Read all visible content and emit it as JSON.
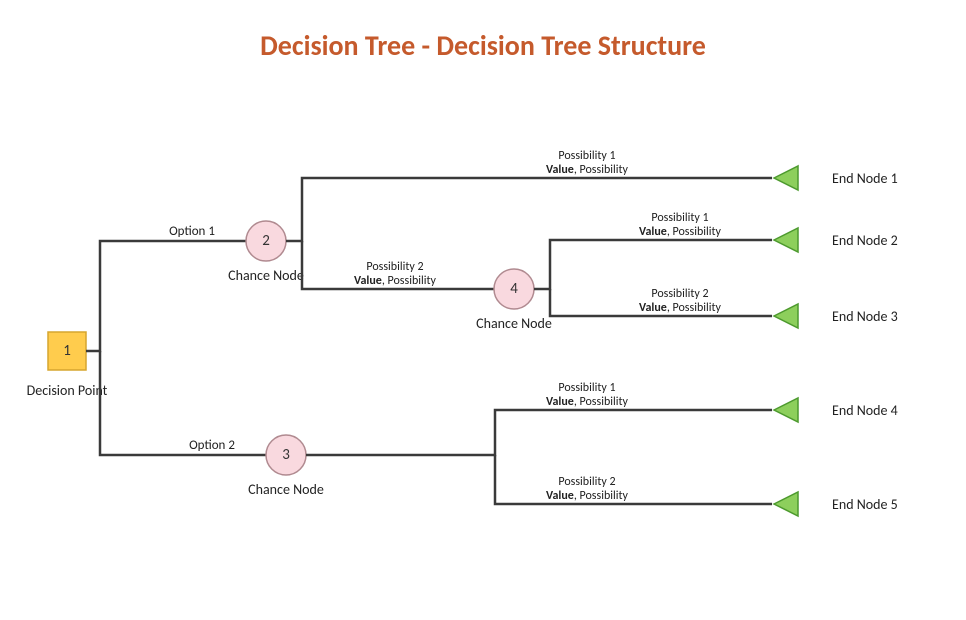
{
  "title": "Decision Tree - Decision Tree Structure",
  "decision": {
    "num": "1",
    "label": "Decision Point"
  },
  "chance2": {
    "num": "2",
    "label": "Chance Node"
  },
  "chance3": {
    "num": "3",
    "label": "Chance Node"
  },
  "chance4": {
    "num": "4",
    "label": "Chance Node"
  },
  "options": {
    "o1": "Option 1",
    "o2": "Option 2"
  },
  "poss": {
    "p1_top": "Possibility 1",
    "p1_bot_bold": "Value",
    "p1_bot_rest": ", Possibility",
    "p2_top": "Possibility 2",
    "p2_bot_bold": "Value",
    "p2_bot_rest": ", Possibility"
  },
  "ends": {
    "e1": "End Node 1",
    "e2": "End Node 2",
    "e3": "End Node 3",
    "e4": "End Node 4",
    "e5": "End Node 5"
  }
}
